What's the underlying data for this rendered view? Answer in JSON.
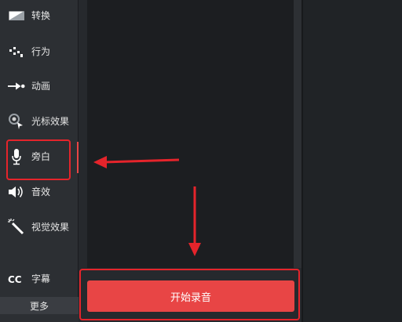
{
  "sidebar": {
    "items": [
      {
        "icon": "transition-icon",
        "label": "转换"
      },
      {
        "icon": "behavior-icon",
        "label": "行为"
      },
      {
        "icon": "animation-icon",
        "label": "动画"
      },
      {
        "icon": "cursor-effects-icon",
        "label": "光标效果"
      },
      {
        "icon": "microphone-icon",
        "label": "旁白"
      },
      {
        "icon": "speaker-icon",
        "label": "音效"
      },
      {
        "icon": "magic-wand-icon",
        "label": "视觉效果"
      },
      {
        "icon": "cc-icon",
        "label": "字幕"
      }
    ],
    "more_label": "更多",
    "active_item": "旁白"
  },
  "panel": {
    "record_button_label": "开始录音"
  },
  "colors": {
    "accent_red": "#e84545",
    "annotation_red": "#e5242b",
    "sidebar_bg": "#2c2f33"
  }
}
